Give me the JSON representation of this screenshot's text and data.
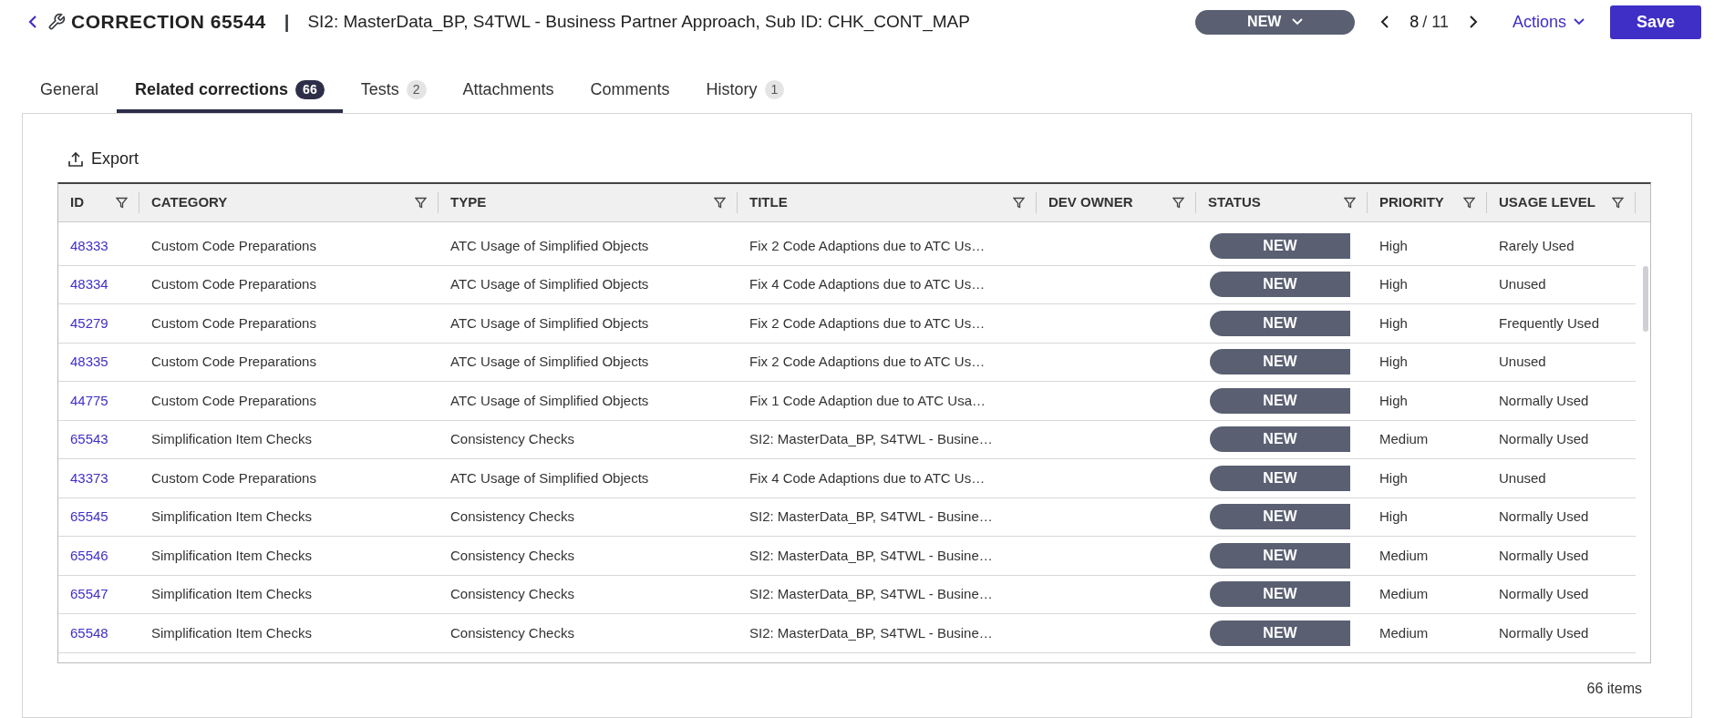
{
  "header": {
    "title": "CORRECTION 65544",
    "separator": "|",
    "subtitle": "SI2: MasterData_BP, S4TWL - Business Partner Approach, Sub ID: CHK_CONT_MAP",
    "status": "NEW",
    "pager": {
      "current": "8",
      "total": "/ 11"
    },
    "actions": "Actions",
    "save": "Save"
  },
  "tabs": [
    {
      "label": "General",
      "selected": false
    },
    {
      "label": "Related corrections",
      "count": "66",
      "selected": true
    },
    {
      "label": "Tests",
      "count": "2",
      "selected": false
    },
    {
      "label": "Attachments",
      "selected": false
    },
    {
      "label": "Comments",
      "selected": false
    },
    {
      "label": "History",
      "count": "1",
      "selected": false
    }
  ],
  "export": "Export",
  "table": {
    "columns": [
      "ID",
      "CATEGORY",
      "TYPE",
      "TITLE",
      "DEV OWNER",
      "STATUS",
      "PRIORITY",
      "USAGE LEVEL"
    ],
    "rows": [
      {
        "id": "48333",
        "category": "Custom Code Preparations",
        "type": "ATC Usage of Simplified Objects",
        "title": "Fix 2 Code Adaptions due to ATC Us…",
        "status": "NEW",
        "priority": "High",
        "usage": "Rarely Used"
      },
      {
        "id": "48334",
        "category": "Custom Code Preparations",
        "type": "ATC Usage of Simplified Objects",
        "title": "Fix 4 Code Adaptions due to ATC Us…",
        "status": "NEW",
        "priority": "High",
        "usage": "Unused"
      },
      {
        "id": "45279",
        "category": "Custom Code Preparations",
        "type": "ATC Usage of Simplified Objects",
        "title": "Fix 2 Code Adaptions due to ATC Us…",
        "status": "NEW",
        "priority": "High",
        "usage": "Frequently Used"
      },
      {
        "id": "48335",
        "category": "Custom Code Preparations",
        "type": "ATC Usage of Simplified Objects",
        "title": "Fix 2 Code Adaptions due to ATC Us…",
        "status": "NEW",
        "priority": "High",
        "usage": "Unused"
      },
      {
        "id": "44775",
        "category": "Custom Code Preparations",
        "type": "ATC Usage of Simplified Objects",
        "title": "Fix 1 Code Adaption due to ATC Usa…",
        "status": "NEW",
        "priority": "High",
        "usage": "Normally Used"
      },
      {
        "id": "65543",
        "category": "Simplification Item Checks",
        "type": "Consistency Checks",
        "title": "SI2: MasterData_BP, S4TWL - Busine…",
        "status": "NEW",
        "priority": "Medium",
        "usage": "Normally Used"
      },
      {
        "id": "43373",
        "category": "Custom Code Preparations",
        "type": "ATC Usage of Simplified Objects",
        "title": "Fix 4 Code Adaptions due to ATC Us…",
        "status": "NEW",
        "priority": "High",
        "usage": "Unused"
      },
      {
        "id": "65545",
        "category": "Simplification Item Checks",
        "type": "Consistency Checks",
        "title": "SI2: MasterData_BP, S4TWL - Busine…",
        "status": "NEW",
        "priority": "High",
        "usage": "Normally Used"
      },
      {
        "id": "65546",
        "category": "Simplification Item Checks",
        "type": "Consistency Checks",
        "title": "SI2: MasterData_BP, S4TWL - Busine…",
        "status": "NEW",
        "priority": "Medium",
        "usage": "Normally Used"
      },
      {
        "id": "65547",
        "category": "Simplification Item Checks",
        "type": "Consistency Checks",
        "title": "SI2: MasterData_BP, S4TWL - Busine…",
        "status": "NEW",
        "priority": "Medium",
        "usage": "Normally Used"
      },
      {
        "id": "65548",
        "category": "Simplification Item Checks",
        "type": "Consistency Checks",
        "title": "SI2: MasterData_BP, S4TWL - Busine…",
        "status": "NEW",
        "priority": "Medium",
        "usage": "Normally Used"
      }
    ]
  },
  "footer": "66 items"
}
